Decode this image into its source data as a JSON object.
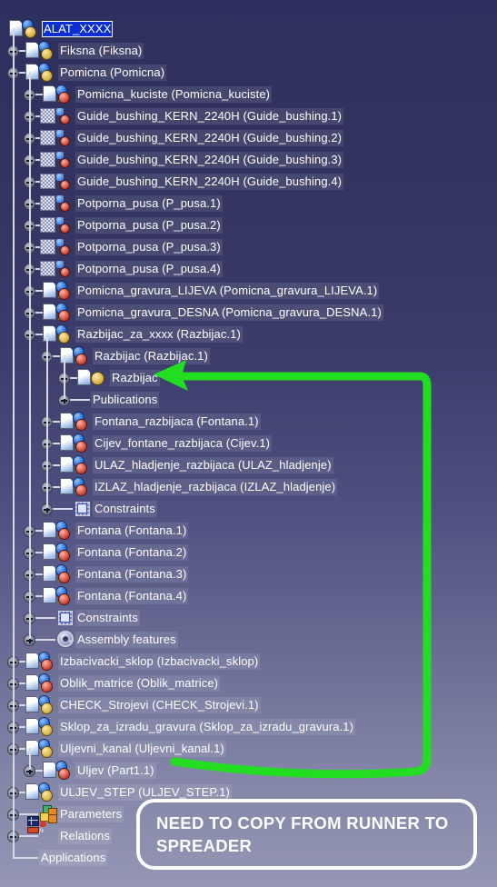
{
  "window": {
    "title": "CATIA specification tree",
    "selected_item": "ALAT_XXXX"
  },
  "colors": {
    "background_top": "#2e2f5e",
    "background_bottom": "#9496b4",
    "selection": "#0b2ed2",
    "annotation_arrow": "#22dd22",
    "callout_border": "#ffffff",
    "text": "#ffffff",
    "tree_line": "#d8d8e4"
  },
  "annotation": {
    "callout_text": "NEED TO COPY FROM RUNNER TO SPREADER",
    "arrow_name": "green-curved-arrow",
    "arrow_from": "Uljev (Part1.1)",
    "arrow_to": "Razbijac"
  },
  "tree": {
    "items": [
      {
        "label": "ALAT_XXXX",
        "level": 0,
        "icon": "assembly-product-icon",
        "expander": "none",
        "selected": true
      },
      {
        "label": "Fiksna (Fiksna)",
        "level": 1,
        "icon": "assembly-product-icon",
        "expander": "plus"
      },
      {
        "label": "Pomicna (Pomicna)",
        "level": 1,
        "icon": "assembly-product-icon",
        "expander": "minus"
      },
      {
        "label": "Pomicna_kuciste (Pomicna_kuciste)",
        "level": 2,
        "icon": "part-body-icon",
        "expander": "plus"
      },
      {
        "label": "Guide_bushing_KERN_2240H (Guide_bushing.1)",
        "level": 2,
        "icon": "catalog-part-icon",
        "expander": "plus"
      },
      {
        "label": "Guide_bushing_KERN_2240H (Guide_bushing.2)",
        "level": 2,
        "icon": "catalog-part-icon",
        "expander": "plus"
      },
      {
        "label": "Guide_bushing_KERN_2240H (Guide_bushing.3)",
        "level": 2,
        "icon": "catalog-part-icon",
        "expander": "plus"
      },
      {
        "label": "Guide_bushing_KERN_2240H (Guide_bushing.4)",
        "level": 2,
        "icon": "catalog-part-icon",
        "expander": "plus"
      },
      {
        "label": "Potporna_pusa (P_pusa.1)",
        "level": 2,
        "icon": "catalog-part-icon",
        "expander": "plus"
      },
      {
        "label": "Potporna_pusa (P_pusa.2)",
        "level": 2,
        "icon": "catalog-part-icon",
        "expander": "plus"
      },
      {
        "label": "Potporna_pusa (P_pusa.3)",
        "level": 2,
        "icon": "catalog-part-icon",
        "expander": "plus"
      },
      {
        "label": "Potporna_pusa (P_pusa.4)",
        "level": 2,
        "icon": "catalog-part-icon",
        "expander": "plus"
      },
      {
        "label": "Pomicna_gravura_LIJEVA (Pomicna_gravura_LIJEVA.1)",
        "level": 2,
        "icon": "part-body-icon",
        "expander": "plus"
      },
      {
        "label": "Pomicna_gravura_DESNA (Pomicna_gravura_DESNA.1)",
        "level": 2,
        "icon": "part-body-icon",
        "expander": "plus"
      },
      {
        "label": "Razbijac_za_xxxx (Razbijac.1)",
        "level": 2,
        "icon": "assembly-product-icon",
        "expander": "minus"
      },
      {
        "label": "Razbijac (Razbijac.1)",
        "level": 3,
        "icon": "part-body-icon",
        "expander": "minus"
      },
      {
        "label": "Razbijac",
        "level": 4,
        "icon": "body-gear-icon",
        "expander": "plus"
      },
      {
        "label": "Publications",
        "level": 4,
        "icon": "none",
        "expander": "plus"
      },
      {
        "label": "Fontana_razbijaca (Fontana.1)",
        "level": 3,
        "icon": "part-body-icon",
        "expander": "plus"
      },
      {
        "label": "Cijev_fontane_razbijaca (Cijev.1)",
        "level": 3,
        "icon": "part-body-icon",
        "expander": "plus"
      },
      {
        "label": "ULAZ_hladjenje_razbijaca (ULAZ_hladjenje)",
        "level": 3,
        "icon": "part-body-icon",
        "expander": "plus"
      },
      {
        "label": "IZLAZ_hladjenje_razbijaca (IZLAZ_hladjenje)",
        "level": 3,
        "icon": "part-body-icon",
        "expander": "plus"
      },
      {
        "label": "Constraints",
        "level": 3,
        "icon": "constraints-icon",
        "expander": "plus"
      },
      {
        "label": "Fontana (Fontana.1)",
        "level": 2,
        "icon": "part-body-icon",
        "expander": "plus"
      },
      {
        "label": "Fontana (Fontana.2)",
        "level": 2,
        "icon": "part-body-icon",
        "expander": "plus"
      },
      {
        "label": "Fontana (Fontana.3)",
        "level": 2,
        "icon": "part-body-icon",
        "expander": "plus"
      },
      {
        "label": "Fontana (Fontana.4)",
        "level": 2,
        "icon": "part-body-icon",
        "expander": "plus"
      },
      {
        "label": "Constraints",
        "level": 2,
        "icon": "constraints-icon",
        "expander": "plus"
      },
      {
        "label": "Assembly features",
        "level": 2,
        "icon": "assembly-features-icon",
        "expander": "plus"
      },
      {
        "label": "Izbacivacki_sklop (Izbacivacki_sklop)",
        "level": 1,
        "icon": "part-body-icon",
        "expander": "plus"
      },
      {
        "label": "Oblik_matrice (Oblik_matrice)",
        "level": 1,
        "icon": "part-body-icon",
        "expander": "plus"
      },
      {
        "label": "CHECK_Strojevi (CHECK_Strojevi.1)",
        "level": 1,
        "icon": "assembly-product-icon",
        "expander": "plus"
      },
      {
        "label": "Sklop_za_izradu_gravura (Sklop_za_izradu_gravura.1)",
        "level": 1,
        "icon": "assembly-product-icon",
        "expander": "plus"
      },
      {
        "label": "Uljevni_kanal (Uljevni_kanal.1)",
        "level": 1,
        "icon": "assembly-product-icon",
        "expander": "minus"
      },
      {
        "label": "Uljev (Part1.1)",
        "level": 2,
        "icon": "part-body-icon",
        "expander": "plus"
      },
      {
        "label": "ULJEV_STEP (ULJEV_STEP.1)",
        "level": 1,
        "icon": "assembly-product-icon",
        "expander": "plus"
      },
      {
        "label": "Parameters",
        "level": 1,
        "icon": "parameters-icon",
        "expander": "plus"
      },
      {
        "label": "Relations",
        "level": 1,
        "icon": "relations-icon",
        "expander": "plus"
      },
      {
        "label": "Applications",
        "level": 1,
        "icon": "none",
        "expander": "none"
      }
    ]
  }
}
